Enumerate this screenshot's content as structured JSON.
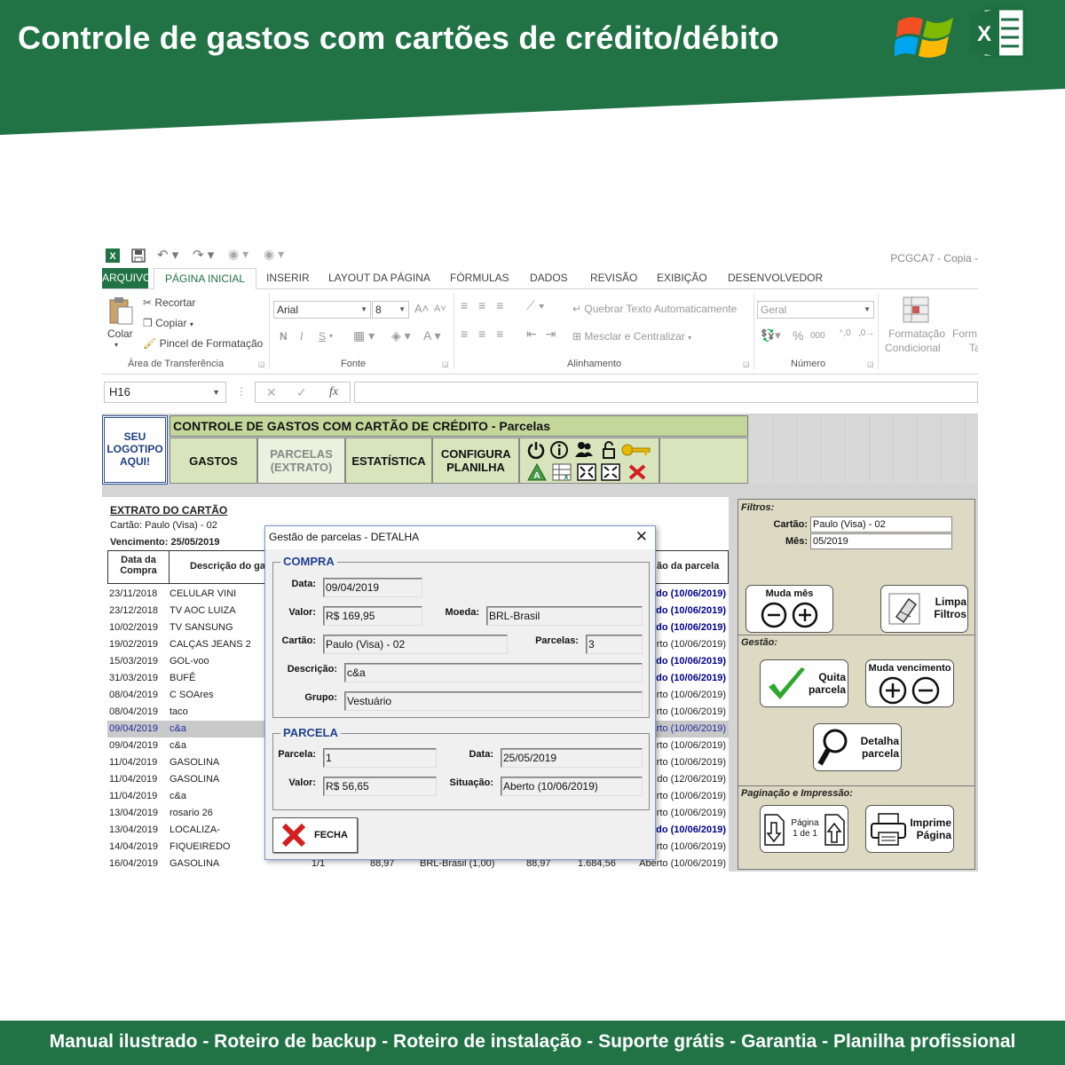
{
  "banner": {
    "title": "Controle de gastos com cartões de crédito/débito",
    "footer": "Manual ilustrado - Roteiro de backup - Roteiro de instalação - Suporte grátis - Garantia - Planilha profissional",
    "green": "#217346"
  },
  "excel": {
    "doc_title": "PCGCA7 - Copia -",
    "tabs": [
      "ARQUIVO",
      "PÁGINA INICIAL",
      "INSERIR",
      "LAYOUT DA PÁGINA",
      "FÓRMULAS",
      "DADOS",
      "REVISÃO",
      "EXIBIÇÃO",
      "DESENVOLVEDOR"
    ],
    "ribbon": {
      "colar": "Colar",
      "recortar": "Recortar",
      "copiar": "Copiar",
      "pincel": "Pincel de Formatação",
      "grp_clipboard": "Área de Transferência",
      "font_name": "Arial",
      "font_size": "8",
      "bold": "N",
      "italic": "I",
      "underline": "S",
      "grp_fonte": "Fonte",
      "wrap": "Quebrar Texto Automaticamente",
      "merge": "Mesclar e Centralizar",
      "grp_alinhamento": "Alinhamento",
      "number_format": "Geral",
      "percent": "%",
      "thousands": "000",
      "grp_numero": "Número",
      "cond_format_1": "Formatação",
      "cond_format_2": "Condicional",
      "format_cut": "Form",
      "format_cut_2": "Ta"
    },
    "name_box": "H16",
    "fx": "fx"
  },
  "sheet": {
    "logo": [
      "SEU",
      "LOGOTIPO",
      "AQUI!"
    ],
    "header": "CONTROLE DE GASTOS COM CARTÃO DE CRÉDITO  -  Parcelas",
    "nav": [
      "GASTOS",
      "PARCELAS (EXTRATO)",
      "ESTATÍSTICA",
      "CONFIGURA PLANILHA"
    ],
    "extrato_title": "EXTRATO DO CARTÃO",
    "cartao_line": "Cartão: Paulo (Visa) - 02",
    "vencimento_line": "Vencimento: 25/05/2019",
    "col_data": [
      "Data da",
      "Compra"
    ],
    "col_desc": "Descrição do ga",
    "col_sit": "ão da parcela",
    "rows": [
      {
        "d": "23/11/2018",
        "desc": "CELULAR VINI",
        "s": "do (10/06/2019)",
        "blue": true
      },
      {
        "d": "23/12/2018",
        "desc": "TV AOC LUIZA",
        "s": "do (10/06/2019)",
        "blue": true
      },
      {
        "d": "10/02/2019",
        "desc": "TV SANSUNG",
        "s": "do (10/06/2019)",
        "blue": true
      },
      {
        "d": "19/02/2019",
        "desc": "CALÇAS JEANS 2",
        "s": "rto (10/06/2019)",
        "blue": false
      },
      {
        "d": "15/03/2019",
        "desc": "GOL-voo",
        "s": "do (10/06/2019)",
        "blue": true
      },
      {
        "d": "31/03/2019",
        "desc": "BUFÊ",
        "s": "do (10/06/2019)",
        "blue": true
      },
      {
        "d": "08/04/2019",
        "desc": "C SOAres",
        "s": "rto (10/06/2019)",
        "blue": false
      },
      {
        "d": "08/04/2019",
        "desc": "taco",
        "s": "rto (10/06/2019)",
        "blue": false
      },
      {
        "d": "09/04/2019",
        "desc": "c&a",
        "s": "rto (10/06/2019)",
        "blue": false,
        "sel": true
      },
      {
        "d": "09/04/2019",
        "desc": "c&a",
        "s": "rto (10/06/2019)",
        "blue": false
      },
      {
        "d": "11/04/2019",
        "desc": "GASOLINA",
        "s": "rto (10/06/2019)",
        "blue": false
      },
      {
        "d": "11/04/2019",
        "desc": "GASOLINA",
        "s": "do (12/06/2019)",
        "blue": false
      },
      {
        "d": "11/04/2019",
        "desc": "c&a",
        "s": "rto (10/06/2019)",
        "blue": false
      },
      {
        "d": "13/04/2019",
        "desc": "rosario 26",
        "s": "rto (10/06/2019)",
        "blue": false
      },
      {
        "d": "13/04/2019",
        "desc": "LOCALIZA-",
        "s": "do (10/06/2019)",
        "blue": true
      },
      {
        "d": "14/04/2019",
        "desc": "FIQUEIREDO",
        "s": "rto (10/06/2019)",
        "blue": false
      },
      {
        "d": "16/04/2019",
        "desc": "GASOLINA",
        "s": "Aberto (10/06/2019)",
        "blue": false
      }
    ],
    "last_row_extra": [
      "1/1",
      "88,97",
      "BRL-Brasil (1,00)",
      "88,97",
      "1.684,56"
    ]
  },
  "panel": {
    "filtros": "Filtros:",
    "cartao_label": "Cartão:",
    "cartao_value": "Paulo (Visa) - 02",
    "mes_label": "Mês:",
    "mes_value": "05/2019",
    "muda_mes": "Muda mês",
    "limpa_filtros": [
      "Limpa",
      "Filtros"
    ],
    "gestao": "Gestão:",
    "quita_parcela": [
      "Quita",
      "parcela"
    ],
    "muda_vencimento": "Muda vencimento",
    "detalha_parcela": [
      "Detalha",
      "parcela"
    ],
    "paginacao": "Paginação e Impressão:",
    "pagina": [
      "Página",
      "1 de 1"
    ],
    "imprime": [
      "Imprime",
      "Página"
    ]
  },
  "dialog": {
    "title": "Gestão de parcelas - DETALHA",
    "compra_legend": "COMPRA",
    "data_label": "Data:",
    "data_value": "09/04/2019",
    "valor_label": "Valor:",
    "valor_value": "R$ 169,95",
    "moeda_label": "Moeda:",
    "moeda_value": "BRL-Brasil",
    "cartao_label": "Cartão:",
    "cartao_value": "Paulo (Visa) - 02",
    "parcelas_label": "Parcelas:",
    "parcelas_value": "3",
    "descricao_label": "Descrição:",
    "descricao_value": "c&a",
    "grupo_label": "Grupo:",
    "grupo_value": "Vestuário",
    "parcela_legend": "PARCELA",
    "parcela_label": "Parcela:",
    "parcela_value": "1",
    "pdata_label": "Data:",
    "pdata_value": "25/05/2019",
    "pvalor_label": "Valor:",
    "pvalor_value": "R$ 56,65",
    "situacao_label": "Situação:",
    "situacao_value": "Aberto  (10/06/2019)",
    "fecha": "FECHA"
  }
}
